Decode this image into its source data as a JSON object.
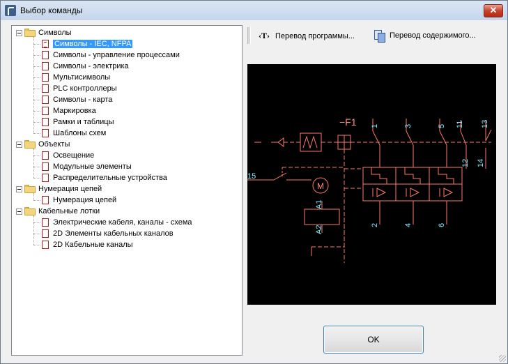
{
  "window": {
    "title": "Выбор команды",
    "close_label": "✕"
  },
  "tree": {
    "groups": [
      {
        "label": "Символы",
        "children": [
          {
            "label": "Символы - IEC, NFPA",
            "selected": true
          },
          {
            "label": "Символы - управление процессами"
          },
          {
            "label": "Символы - электрика"
          },
          {
            "label": "Мультисимволы"
          },
          {
            "label": "PLC контроллеры"
          },
          {
            "label": "Символы - карта"
          },
          {
            "label": "Маркировка"
          },
          {
            "label": "Рамки и таблицы"
          },
          {
            "label": "Шаблоны схем"
          }
        ]
      },
      {
        "label": "Объекты",
        "children": [
          {
            "label": "Освещение"
          },
          {
            "label": "Модульные элементы"
          },
          {
            "label": "Распределительные устройства"
          }
        ]
      },
      {
        "label": "Нумерация цепей",
        "children": [
          {
            "label": "Нумерация цепей"
          }
        ]
      },
      {
        "label": "Кабельные лотки",
        "children": [
          {
            "label": "Электрические кабеля, каналы - схема"
          },
          {
            "label": "2D Элементы кабельных каналов"
          },
          {
            "label": "2D Кабельные каналы"
          }
        ]
      }
    ]
  },
  "toolbar": {
    "translate_program_icon": "‹T›",
    "translate_program_label": "Перевод программы...",
    "translate_content_label": "Перевод содержимого..."
  },
  "preview": {
    "labels": {
      "f1": "−F1",
      "p1": "1",
      "p3": "3",
      "p5": "5",
      "p11": "11",
      "p13": "13",
      "p2": "2",
      "p4": "4",
      "p6": "6",
      "p12": "12",
      "p14": "14",
      "p15": "15",
      "motor": "M",
      "a1": "A1",
      "a2": "A2"
    },
    "colors": {
      "background": "#000000",
      "wire": "#ff7a6b",
      "text": "#7ff0ff",
      "device": "#ff8f80"
    }
  },
  "buttons": {
    "ok": "OK"
  }
}
